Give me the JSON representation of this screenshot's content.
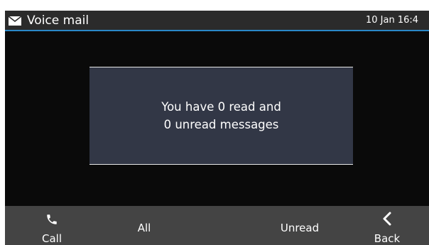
{
  "titlebar": {
    "title": "Voice mail",
    "clock": "10 Jan 16:4",
    "icon": "mail-icon",
    "accent_color": "#2a88c8"
  },
  "dialog": {
    "line1": "You have 0 read and",
    "line2": "0 unread messages"
  },
  "softkeys": {
    "call": {
      "label": "Call",
      "icon": "phone-icon"
    },
    "all": {
      "label": "All"
    },
    "unread": {
      "label": "Unread"
    },
    "back": {
      "label": "Back",
      "icon": "chevron-left-icon"
    }
  }
}
